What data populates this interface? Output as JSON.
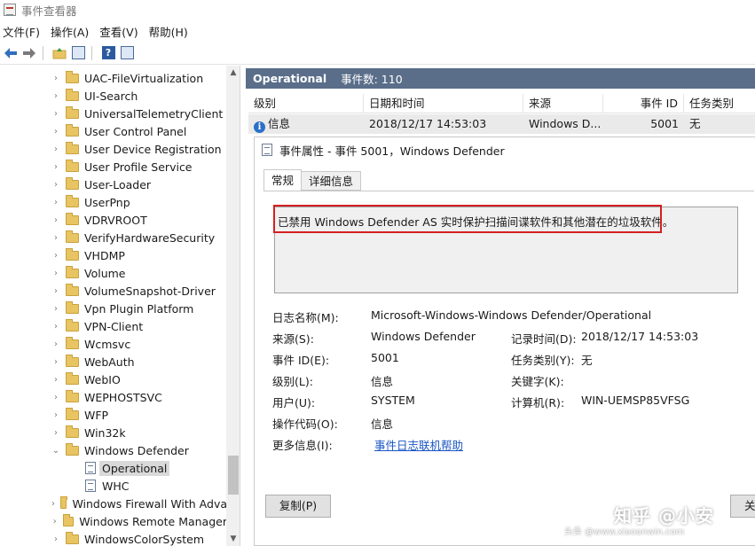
{
  "window": {
    "title": "事件查看器"
  },
  "menu": [
    {
      "label": "文件(F)"
    },
    {
      "label": "操作(A)"
    },
    {
      "label": "查看(V)"
    },
    {
      "label": "帮助(H)"
    }
  ],
  "toolbar": {
    "buttons": [
      "back-arrow-icon",
      "forward-arrow-icon",
      "folder-up-icon",
      "show-pane-icon",
      "help-icon",
      "properties-pane-icon"
    ]
  },
  "tree": {
    "items": [
      {
        "label": "UAC-FileVirtualization",
        "type": "folder"
      },
      {
        "label": "UI-Search",
        "type": "folder"
      },
      {
        "label": "UniversalTelemetryClient",
        "type": "folder"
      },
      {
        "label": "User Control Panel",
        "type": "folder"
      },
      {
        "label": "User Device Registration",
        "type": "folder"
      },
      {
        "label": "User Profile Service",
        "type": "folder"
      },
      {
        "label": "User-Loader",
        "type": "folder"
      },
      {
        "label": "UserPnp",
        "type": "folder"
      },
      {
        "label": "VDRVROOT",
        "type": "folder"
      },
      {
        "label": "VerifyHardwareSecurity",
        "type": "folder"
      },
      {
        "label": "VHDMP",
        "type": "folder"
      },
      {
        "label": "Volume",
        "type": "folder"
      },
      {
        "label": "VolumeSnapshot-Driver",
        "type": "folder"
      },
      {
        "label": "Vpn Plugin Platform",
        "type": "folder"
      },
      {
        "label": "VPN-Client",
        "type": "folder"
      },
      {
        "label": "Wcmsvc",
        "type": "folder"
      },
      {
        "label": "WebAuth",
        "type": "folder"
      },
      {
        "label": "WebIO",
        "type": "folder"
      },
      {
        "label": "WEPHOSTSVC",
        "type": "folder"
      },
      {
        "label": "WFP",
        "type": "folder"
      },
      {
        "label": "Win32k",
        "type": "folder"
      },
      {
        "label": "Windows Defender",
        "type": "folder-open"
      },
      {
        "label": "Operational",
        "type": "log",
        "selected": true
      },
      {
        "label": "WHC",
        "type": "log"
      },
      {
        "label": "Windows Firewall With Adva",
        "type": "folder"
      },
      {
        "label": "Windows Remote Manager",
        "type": "folder"
      },
      {
        "label": "WindowsColorSystem",
        "type": "folder"
      }
    ]
  },
  "panel": {
    "name": "Operational",
    "count_label": "事件数: 110"
  },
  "columns": [
    "级别",
    "日期和时间",
    "来源",
    "事件 ID",
    "任务类别"
  ],
  "event": {
    "level": "信息",
    "datetime": "2018/12/17 14:53:03",
    "source": "Windows D...",
    "id": "5001",
    "category": "无"
  },
  "props": {
    "title": "事件属性 - 事件 5001，Windows Defender",
    "tabs": [
      "常规",
      "详细信息"
    ],
    "description": "已禁用 Windows Defender AS 实时保护扫描间谍软件和其他潜在的垃圾软件。",
    "labels": {
      "log_name": "日志名称(M):",
      "source": "来源(S):",
      "event_id": "事件 ID(E):",
      "level": "级别(L):",
      "user": "用户(U):",
      "opcode": "操作代码(O):",
      "more_info": "更多信息(I):",
      "logged": "记录时间(D):",
      "task_category": "任务类别(Y):",
      "keywords": "关键字(K):",
      "computer": "计算机(R):"
    },
    "values": {
      "log_name": "Microsoft-Windows-Windows Defender/Operational",
      "source": "Windows Defender",
      "event_id": "5001",
      "level": "信息",
      "user": "SYSTEM",
      "opcode": "信息",
      "more_info": "事件日志联机帮助",
      "logged": "2018/12/17 14:53:03",
      "task_category": "无",
      "keywords": "",
      "computer": "WIN-UEMSP85VFSG"
    },
    "copy_label": "复制(P)",
    "close_label": "关"
  },
  "watermark": {
    "text": "知乎 @小安",
    "sub": "头条 @www.xiaoanwin.com"
  },
  "colors": {
    "panel_header": "#5a6e8a",
    "highlight_border": "#d42020",
    "link": "#1a56c4",
    "info": "#2a6fc9"
  }
}
